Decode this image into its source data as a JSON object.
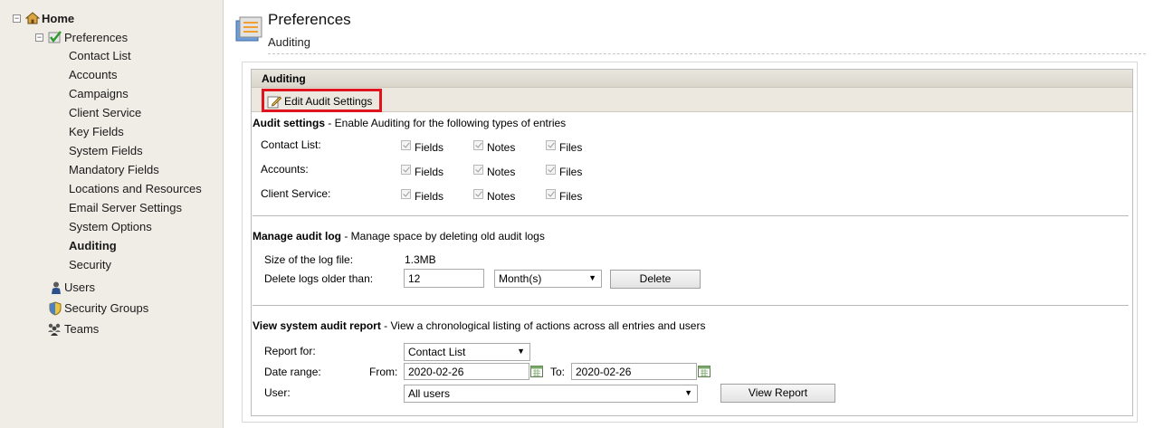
{
  "sidebar": {
    "home": "Home",
    "preferences": "Preferences",
    "pref_items": [
      "Contact List",
      "Accounts",
      "Campaigns",
      "Client Service",
      "Key Fields",
      "System Fields",
      "Mandatory Fields",
      "Locations and Resources",
      "Email Server Settings",
      "System Options",
      "Auditing",
      "Security"
    ],
    "users": "Users",
    "security_groups": "Security Groups",
    "teams": "Teams"
  },
  "header": {
    "title": "Preferences",
    "subtitle": "Auditing"
  },
  "panel": {
    "title": "Auditing",
    "edit_button": "Edit Audit Settings",
    "audit_settings": {
      "title": "Audit settings",
      "desc": " - Enable Auditing for the following types of entries",
      "rows": [
        {
          "label": "Contact List:",
          "options": [
            "Fields",
            "Notes",
            "Files"
          ]
        },
        {
          "label": "Accounts:",
          "options": [
            "Fields",
            "Notes",
            "Files"
          ]
        },
        {
          "label": "Client Service:",
          "options": [
            "Fields",
            "Notes",
            "Files"
          ]
        }
      ]
    },
    "manage_log": {
      "title": "Manage audit log",
      "desc": " - Manage space by deleting old audit logs",
      "size_label": "Size of the log file:",
      "size_value": "1.3MB",
      "delete_label": "Delete logs older than:",
      "delete_value": "12",
      "unit": "Month(s)",
      "delete_button": "Delete"
    },
    "report": {
      "title": "View system audit report",
      "desc": " - View a chronological listing of actions across all entries and users",
      "report_for_label": "Report for:",
      "report_for_value": "Contact List",
      "date_range_label": "Date range:",
      "from_label": "From:",
      "from_value": "2020-02-26",
      "to_label": "To:",
      "to_value": "2020-02-26",
      "user_label": "User:",
      "user_value": "All users",
      "view_button": "View Report"
    }
  }
}
